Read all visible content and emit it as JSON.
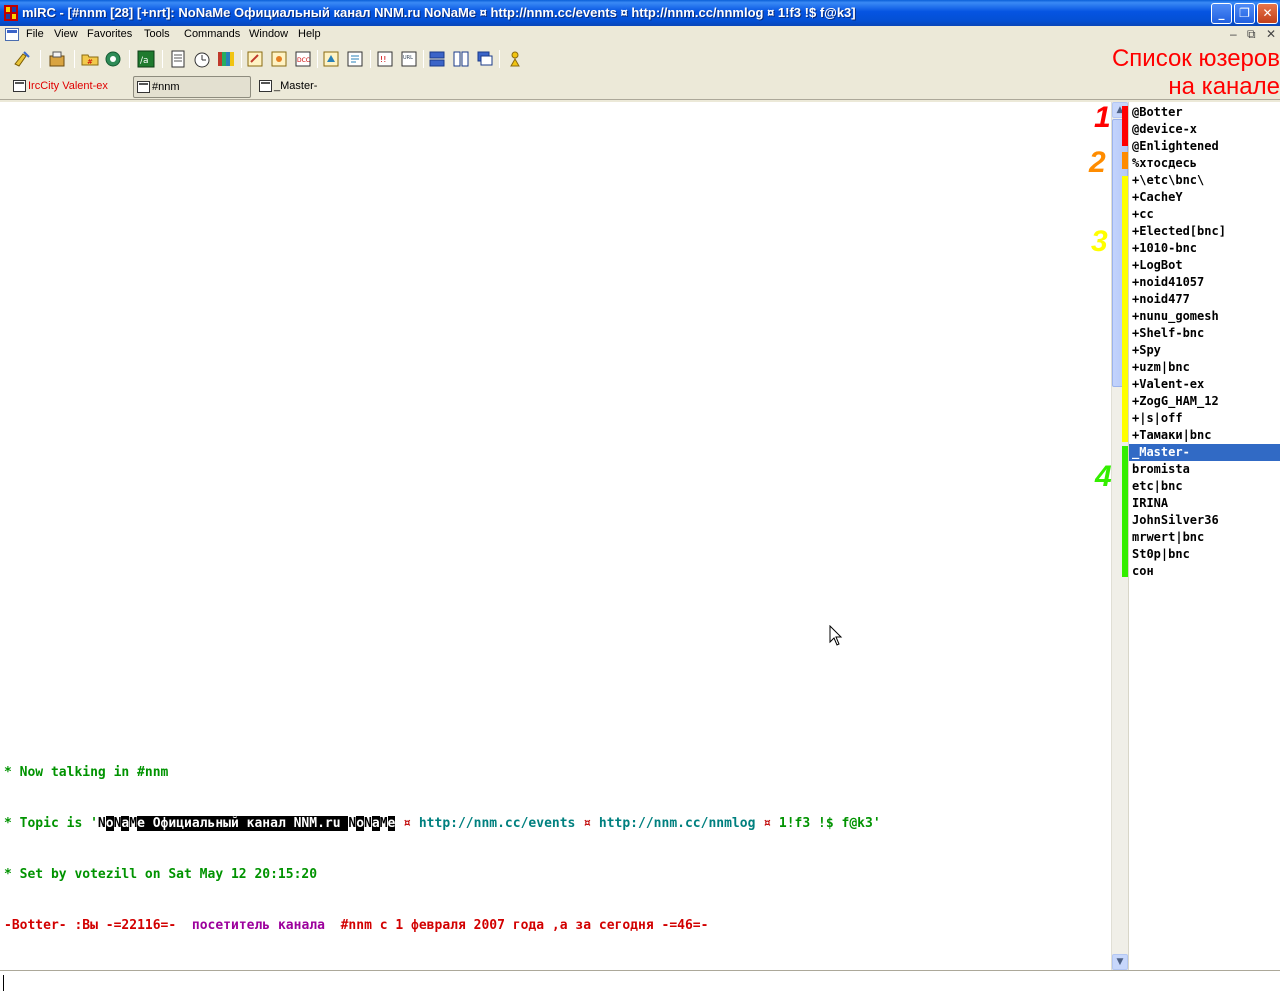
{
  "window": {
    "title": "mIRC - [#nnm [28] [+nrt]: NoNaMe Официальный канал NNM.ru NoNaMe ¤ http://nnm.cc/events ¤ http://nnm.cc/nnmlog ¤ 1!f3 !$ f@k3]",
    "controls": {
      "minimize": "_",
      "restore": "❐",
      "close": "✕"
    }
  },
  "menu": {
    "items": [
      "File",
      "View",
      "Favorites",
      "Tools",
      "Commands",
      "Window",
      "Help"
    ],
    "mdi_controls": {
      "minimize": "‒",
      "restore": "⧉",
      "close": "✕"
    }
  },
  "toolbar": {
    "icons": [
      "connect-icon",
      "options-icon",
      "channels-folder-icon",
      "address-book-icon",
      "scripts-editor-icon",
      "log-viewer-icon",
      "timer-icon",
      "colors-icon",
      "send-file-icon",
      "chat-icon",
      "dcc-icon",
      "notify-icon",
      "url-list-icon",
      "tile-horizontal-icon",
      "tile-vertical-icon",
      "cascade-icon",
      "help-icon"
    ]
  },
  "switchbar": {
    "tabs": [
      {
        "label": "IrcCity Valent-ex",
        "color": "#e00000",
        "active": false
      },
      {
        "label": "#nnm",
        "color": "#000000",
        "active": true
      },
      {
        "label": "_Master-",
        "color": "#000000",
        "active": false
      }
    ]
  },
  "annotation": {
    "title_line1": "Список юзеров",
    "title_line2": "на канале",
    "groups": [
      {
        "number": "1",
        "color": "#ff0000"
      },
      {
        "number": "2",
        "color": "#ff8c00"
      },
      {
        "number": "3",
        "color": "#ffff00"
      },
      {
        "number": "4",
        "color": "#33ee00"
      }
    ]
  },
  "chat": {
    "line1": "* Now talking in #nnm",
    "line2": {
      "prefix": "* Topic is '",
      "n1": "N",
      "o1": "o",
      "N1": "N",
      "a1": "a",
      "M1": "M",
      "e1": "e",
      "middle": " Официальный канал NNM.ru ",
      "n2": "N",
      "o2": "o",
      "N2": "N",
      "a2": "a",
      "M2": "M",
      "e2": "e",
      "sep1": " ¤ ",
      "link1": "http://nnm.cc/events",
      "sep2": " ¤ ",
      "link2": "http://nnm.cc/nnmlog",
      "sep3": " ¤ ",
      "tail": "1!f3 !$ f@k3'"
    },
    "line3": "* Set by votezill on Sat May 12 20:15:20",
    "line4": {
      "nick": "-Botter-",
      "part1": " :Вы ",
      "count": "-=22116=-",
      "part2": "  посетитель канала  ",
      "part3": "#nnm с 1 февраля 2007 года ,а за сегодня ",
      "today": "-=46=-"
    }
  },
  "scrollbar": {
    "up": "▲",
    "down": "▼"
  },
  "nicklist": [
    "@Botter",
    "@device-x",
    "@Enlightened",
    "%хтосдесь",
    "+\\etc\\bnc\\",
    "+CacheY",
    "+cc",
    "+Elected[bnc]",
    "+1010-bnc",
    "+LogBot",
    "+noid41057",
    "+noid477",
    "+nunu_gomesh",
    "+Shelf-bnc",
    "+Spy",
    "+uzm|bnc",
    "+Valent-ex",
    "+ZogG_HAM_12",
    "+|s|off",
    "+Тамаки|bnc",
    "_Master-",
    "bromista",
    "etc|bnc",
    "IRINA",
    "JohnSilver36",
    "mrwert|bnc",
    "St0p|bnc",
    "сон"
  ],
  "selected_nick_index": 20,
  "input": {
    "value": ""
  }
}
